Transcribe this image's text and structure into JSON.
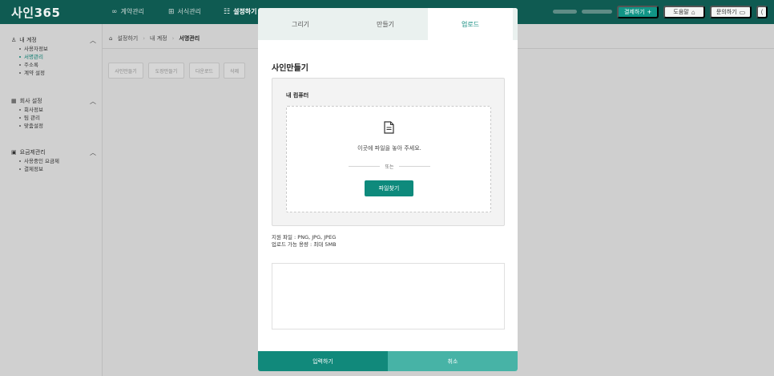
{
  "app": {
    "logo": "사인365"
  },
  "topnav": [
    {
      "icon": "∞",
      "label": "계약관리"
    },
    {
      "icon": "⊞",
      "label": "서식관리"
    },
    {
      "icon": "☷",
      "label": "설정하기"
    }
  ],
  "toolbar": {
    "pay_label": "결제하기",
    "help_label": "도움말",
    "inquiry_label": "문의하기"
  },
  "sidebar": {
    "groups": [
      {
        "title": "내 계정",
        "icon": "person-icon",
        "items": [
          "사용자정보",
          "서명관리",
          "주소록",
          "계약 설정"
        ],
        "active_index": 1
      },
      {
        "title": "회사 설정",
        "icon": "building-icon",
        "items": [
          "회사정보",
          "팀 관리",
          "맞춤설정"
        ],
        "active_index": -1
      },
      {
        "title": "요금제관리",
        "icon": "plan-icon",
        "items": [
          "사용중인 요금제",
          "결제정보"
        ],
        "active_index": -1
      }
    ]
  },
  "breadcrumb": {
    "home_icon": "home-icon",
    "items": [
      "설정하기",
      "내 계정",
      "서명관리"
    ]
  },
  "actions": [
    "사인만들기",
    "도장만들기",
    "다운로드",
    "삭제"
  ],
  "modal": {
    "tabs": [
      "그리기",
      "만들기",
      "업로드"
    ],
    "active_tab": 2,
    "title": "사인만들기",
    "upload_label": "내 컴퓨터",
    "drop_text": "이곳에 파일을 놓아 주세요.",
    "or_text": "또는",
    "find_button": "파일찾기",
    "supported": "지원 파일 : PNG, JPG, JPEG",
    "max_size": "업로드 가능 용량 : 최대 5MB",
    "submit_button": "입력하기",
    "cancel_button": "취소"
  },
  "colors": {
    "brand_dark": "#0f5b52",
    "accent": "#0e8a7c",
    "accent_light": "#47b3a6"
  }
}
